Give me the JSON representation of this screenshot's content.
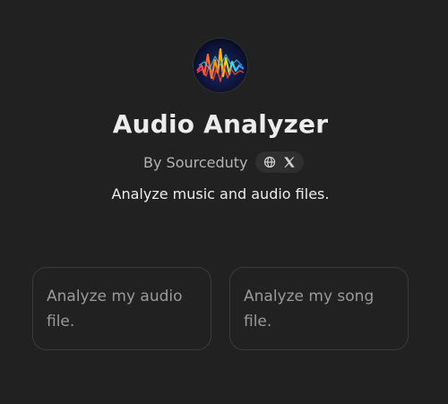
{
  "app": {
    "title": "Audio Analyzer",
    "author": "By Sourceduty",
    "description": "Analyze music and audio files."
  },
  "icons": {
    "avatar": "audio-waveform-logo",
    "website": "globe-icon",
    "social": "x-icon"
  },
  "prompts": [
    {
      "label": "Analyze my audio file."
    },
    {
      "label": "Analyze my song file."
    }
  ],
  "colors": {
    "background": "#212121",
    "card_border": "#3a3a3a",
    "pill_background": "#2f2f2f",
    "text_primary": "#ececec",
    "text_secondary": "#b4b4b4"
  }
}
